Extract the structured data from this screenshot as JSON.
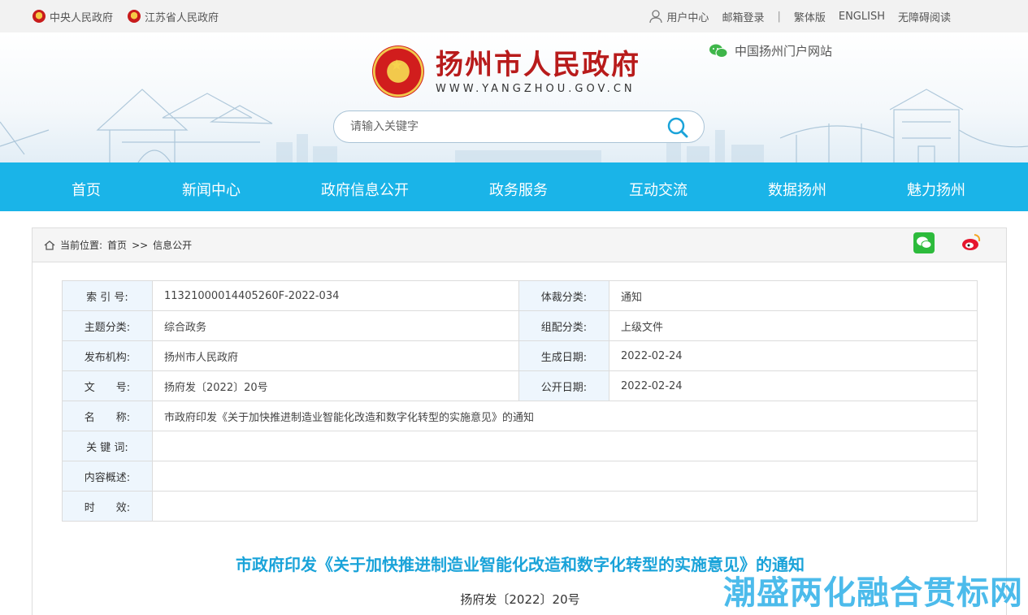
{
  "topbar": {
    "left_links": [
      "中央人民政府",
      "江苏省人民政府"
    ],
    "user_center": "用户中心",
    "mail_login": "邮箱登录",
    "separator": "|",
    "traditional": "繁体版",
    "english": "ENGLISH",
    "accessibility": "无障碍阅读"
  },
  "header": {
    "title": "扬州市人民政府",
    "domain": "WWW.YANGZHOU.GOV.CN",
    "portal": "中国扬州门户网站",
    "search_placeholder": "请输入关键字"
  },
  "nav": [
    "首页",
    "新闻中心",
    "政府信息公开",
    "政务服务",
    "互动交流",
    "数据扬州",
    "魅力扬州"
  ],
  "breadcrumb": {
    "prefix": "当前位置:",
    "home": "首页",
    "sep": ">>",
    "current": "信息公开"
  },
  "meta": {
    "index_label": "索 引 号:",
    "index_value": "11321000014405260F-2022-034",
    "genre_label": "体裁分类:",
    "genre_value": "通知",
    "topic_label": "主题分类:",
    "topic_value": "综合政务",
    "group_label": "组配分类:",
    "group_value": "上级文件",
    "publisher_label": "发布机构:",
    "publisher_value": "扬州市人民政府",
    "created_label": "生成日期:",
    "created_value": "2022-02-24",
    "docno_label": "文　　号:",
    "docno_value": "扬府发〔2022〕20号",
    "public_label": "公开日期:",
    "public_value": "2022-02-24",
    "name_label": "名　　称:",
    "name_value": "市政府印发《关于加快推进制造业智能化改造和数字化转型的实施意见》的通知",
    "keywords_label": "关 键 词:",
    "keywords_value": "",
    "summary_label": "内容概述:",
    "summary_value": "",
    "validity_label": "时　　效:",
    "validity_value": ""
  },
  "document": {
    "title": "市政府印发《关于加快推进制造业智能化改造和数字化转型的实施意见》的通知",
    "number": "扬府发〔2022〕20号"
  },
  "watermark": "潮盛两化融合贯标网",
  "colors": {
    "nav_bg": "#1ab4e8",
    "title_blue": "#1aa3d9",
    "brand_red": "#b81b1b",
    "label_bg": "#eef6fd"
  }
}
